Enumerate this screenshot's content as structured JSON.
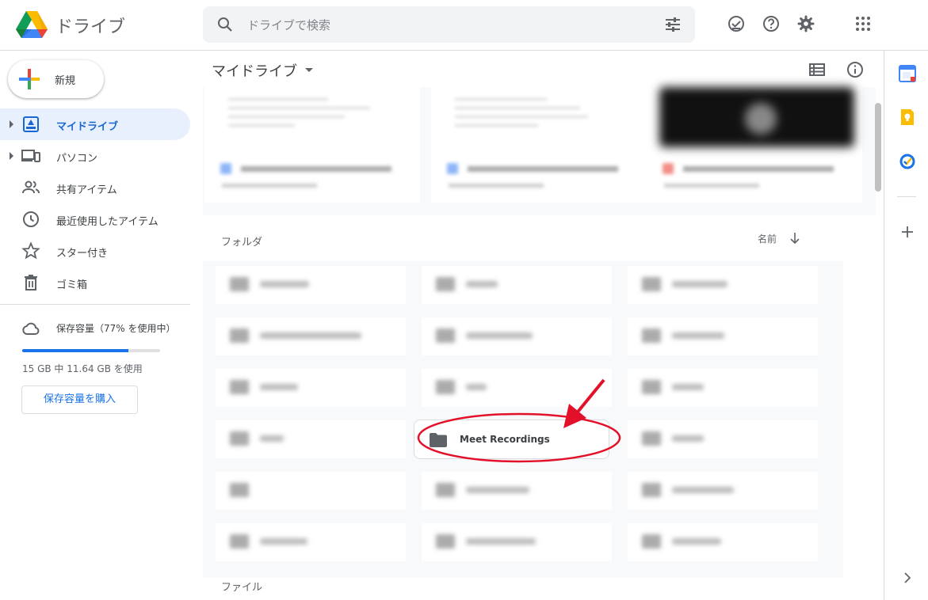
{
  "header": {
    "app_name": "ドライブ",
    "search_placeholder": "ドライブで検索"
  },
  "leftnav": {
    "new_label": "新規",
    "items": [
      {
        "label": "マイドライブ",
        "icon": "my-drive-icon",
        "active": true,
        "caret": true
      },
      {
        "label": "パソコン",
        "icon": "computers-icon",
        "active": false,
        "caret": true
      },
      {
        "label": "共有アイテム",
        "icon": "shared-icon",
        "active": false,
        "caret": false
      },
      {
        "label": "最近使用したアイテム",
        "icon": "recent-clock-icon",
        "active": false,
        "caret": false
      },
      {
        "label": "スター付き",
        "icon": "star-icon",
        "active": false,
        "caret": false
      },
      {
        "label": "ゴミ箱",
        "icon": "trash-icon",
        "active": false,
        "caret": false
      }
    ],
    "storage": {
      "title": "保存容量（77% を使用中）",
      "used_fraction": 0.77,
      "detail": "15 GB 中 11.64 GB を使用",
      "buy_label": "保存容量を購入"
    }
  },
  "main": {
    "breadcrumb": "マイドライブ",
    "folders_label": "フォルダ",
    "sort_label": "名前",
    "files_label": "ファイル",
    "highlighted_folder": "Meet Recordings"
  },
  "colors": {
    "accent": "#1a73e8",
    "active_bg": "#e8f0fe",
    "annotation_red": "#e3102a"
  }
}
